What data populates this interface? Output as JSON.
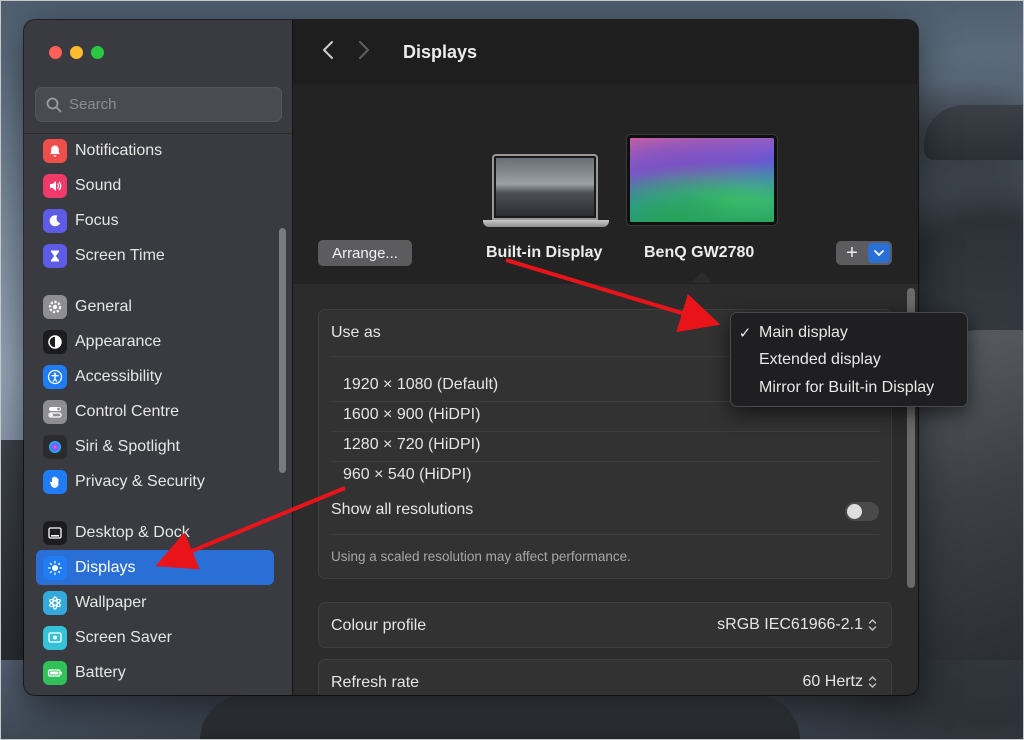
{
  "window": {
    "title": "Displays",
    "traffic_lights": {
      "red": "#fe5f57",
      "yellow": "#febc2e",
      "green": "#28c840"
    }
  },
  "search": {
    "placeholder": "Search",
    "value": ""
  },
  "sidebar": {
    "items": [
      {
        "label": "Notifications",
        "icon": "bell-icon",
        "color": "#f04e4b"
      },
      {
        "label": "Sound",
        "icon": "speaker-icon",
        "color": "#ef3a6a"
      },
      {
        "label": "Focus",
        "icon": "moon-icon",
        "color": "#5e5ce6"
      },
      {
        "label": "Screen Time",
        "icon": "hourglass-icon",
        "color": "#5e5ce6"
      },
      {
        "label": "General",
        "icon": "gear-icon",
        "color": "#8e8e93"
      },
      {
        "label": "Appearance",
        "icon": "appearance-icon",
        "color": "#1c1c1e"
      },
      {
        "label": "Accessibility",
        "icon": "accessibility-icon",
        "color": "#1f7cf4"
      },
      {
        "label": "Control Centre",
        "icon": "toggles-icon",
        "color": "#8e8e93"
      },
      {
        "label": "Siri & Spotlight",
        "icon": "siri-icon",
        "color": "#2b2b2e"
      },
      {
        "label": "Privacy & Security",
        "icon": "hand-icon",
        "color": "#1f7cf4"
      },
      {
        "label": "Desktop & Dock",
        "icon": "dock-icon",
        "color": "#1c1c1e"
      },
      {
        "label": "Displays",
        "icon": "sun-icon",
        "color": "#1f7cf4",
        "active": true
      },
      {
        "label": "Wallpaper",
        "icon": "flower-icon",
        "color": "#34aadc"
      },
      {
        "label": "Screen Saver",
        "icon": "screensaver-icon",
        "color": "#35c1d6"
      },
      {
        "label": "Battery",
        "icon": "battery-icon",
        "color": "#30c15a"
      }
    ]
  },
  "arrange": {
    "button_label": "Arrange...",
    "displays": [
      "Built-in Display",
      "BenQ GW2780"
    ],
    "selected_display": "BenQ GW2780",
    "add_label": "+"
  },
  "use_as": {
    "label": "Use as",
    "menu": [
      {
        "label": "Main display",
        "checked": true
      },
      {
        "label": "Extended display",
        "checked": false
      },
      {
        "label": "Mirror for Built-in Display",
        "checked": false
      }
    ],
    "check_mark": "✓"
  },
  "resolutions": [
    "1920 × 1080 (Default)",
    "1600 × 900 (HiDPI)",
    "1280 × 720 (HiDPI)",
    "960 × 540 (HiDPI)"
  ],
  "show_all": {
    "label": "Show all resolutions",
    "enabled": false
  },
  "performance_note": "Using a scaled resolution may affect performance.",
  "colour_profile": {
    "label": "Colour profile",
    "value": "sRGB IEC61966-2.1"
  },
  "refresh_rate": {
    "label": "Refresh rate",
    "value": "60 Hertz"
  },
  "colors": {
    "accent": "#2a6fd6",
    "annotation_arrow": "#e8141a"
  }
}
